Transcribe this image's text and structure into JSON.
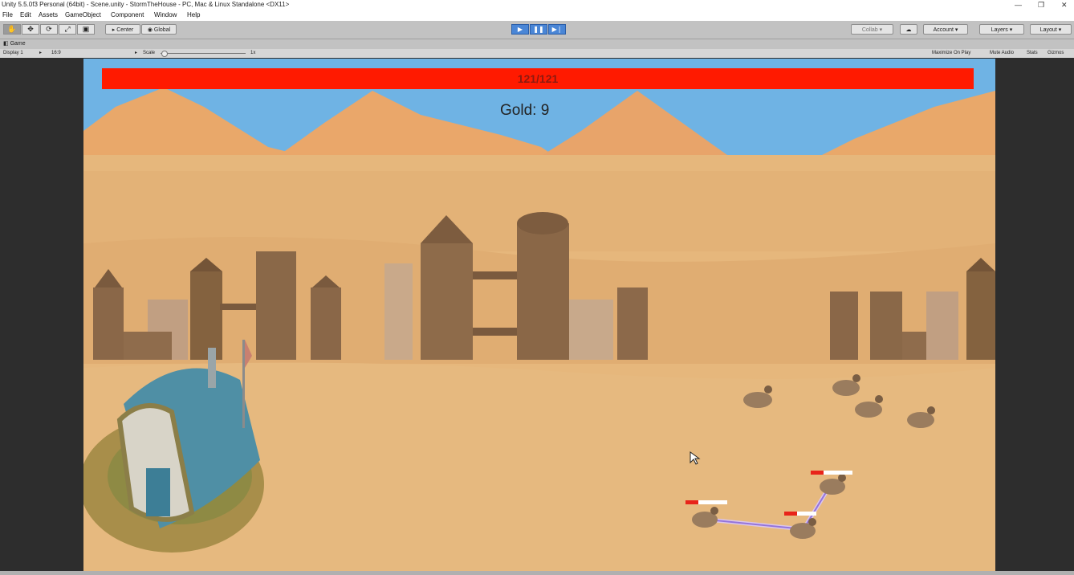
{
  "window": {
    "title": "Unity 5.5.0f3 Personal (64bit) - Scene.unity - StormTheHouse - PC, Mac & Linux Standalone <DX11>"
  },
  "menu": [
    "File",
    "Edit",
    "Assets",
    "GameObject",
    "Component",
    "Window",
    "Help"
  ],
  "toolbar": {
    "tools": [
      "hand-tool-icon",
      "move-tool-icon",
      "rotate-tool-icon",
      "scale-tool-icon",
      "rect-tool-icon"
    ],
    "pivot_label": "Center",
    "space_label": "Global",
    "collab_label": "Collab",
    "account_label": "Account",
    "layers_label": "Layers",
    "layout_label": "Layout"
  },
  "game_tab": {
    "title": "Game",
    "display": "Display 1",
    "aspect": "16:9",
    "scale_label": "Scale",
    "scale_value": "1x",
    "maximize_label": "Maximize On Play",
    "mute_label": "Mute Audio",
    "stats_label": "Stats",
    "gizmos_label": "Gizmos"
  },
  "game": {
    "house_health": "121/121",
    "gold": "Gold: 9",
    "colors": {
      "health_bar": "#ff1a00",
      "sky": "#6fb3e4",
      "sand": "#e4b67a"
    }
  }
}
